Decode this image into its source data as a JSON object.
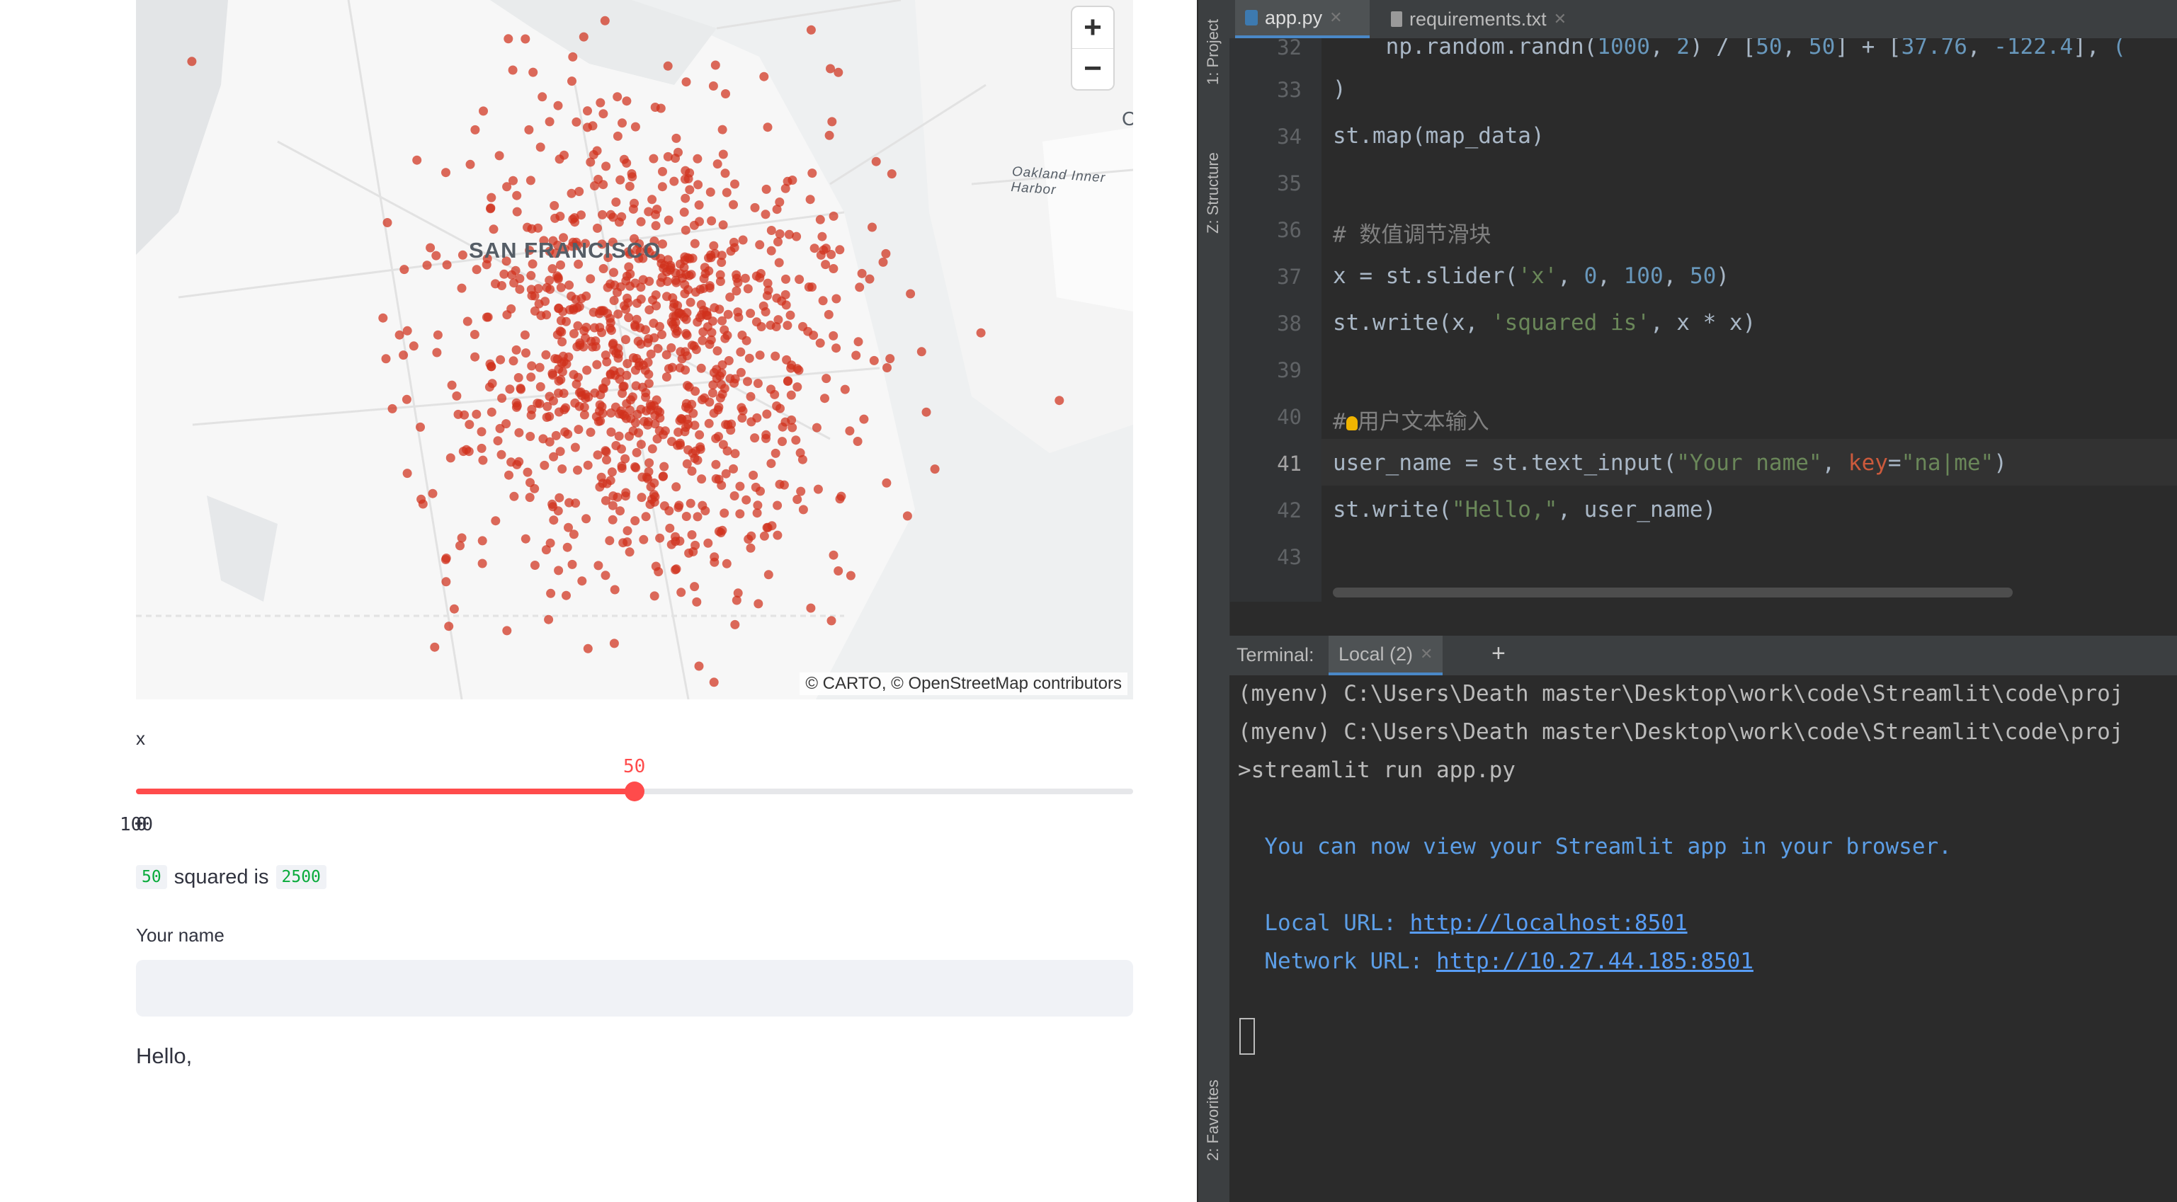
{
  "map": {
    "city_label": "SAN FRANCISCO",
    "water_label": "Oakland Inner Harbor",
    "edge_label": "C",
    "attribution": "© CARTO, © OpenStreetMap contributors",
    "zoom_in": "+",
    "zoom_out": "−",
    "point_color": "#d0301c"
  },
  "slider": {
    "label": "x",
    "value": 50,
    "value_text": "50",
    "min_text": "0",
    "max_text": "100",
    "fraction": 0.5,
    "accent": "#ff4b4b"
  },
  "squared": {
    "x_text": "50",
    "middle": "squared is",
    "result_text": "2500"
  },
  "name_input": {
    "label": "Your name",
    "value": ""
  },
  "hello": "Hello,",
  "ide": {
    "tool_windows": [
      "1: Project",
      "Z: Structure",
      "2: Favorites"
    ],
    "tabs": [
      {
        "label": "app.py",
        "active": true
      },
      {
        "label": "requirements.txt",
        "active": false
      }
    ],
    "line_numbers": [
      "32",
      "33",
      "34",
      "35",
      "36",
      "37",
      "38",
      "39",
      "40",
      "41",
      "42",
      "43"
    ],
    "terminal_title": "Terminal:",
    "terminal_tab": "Local (2)",
    "terminal_add": "+",
    "terminal_lines": [
      "(myenv) C:\\Users\\Death master\\Desktop\\work\\code\\Streamlit\\code\\proj",
      "(myenv) C:\\Users\\Death master\\Desktop\\work\\code\\Streamlit\\code\\proj",
      ">streamlit run app.py",
      "  You can now view your Streamlit app in your browser.",
      "  Local URL: ",
      "http://localhost:8501",
      "  Network URL: ",
      "http://10.27.44.185:8501"
    ]
  }
}
